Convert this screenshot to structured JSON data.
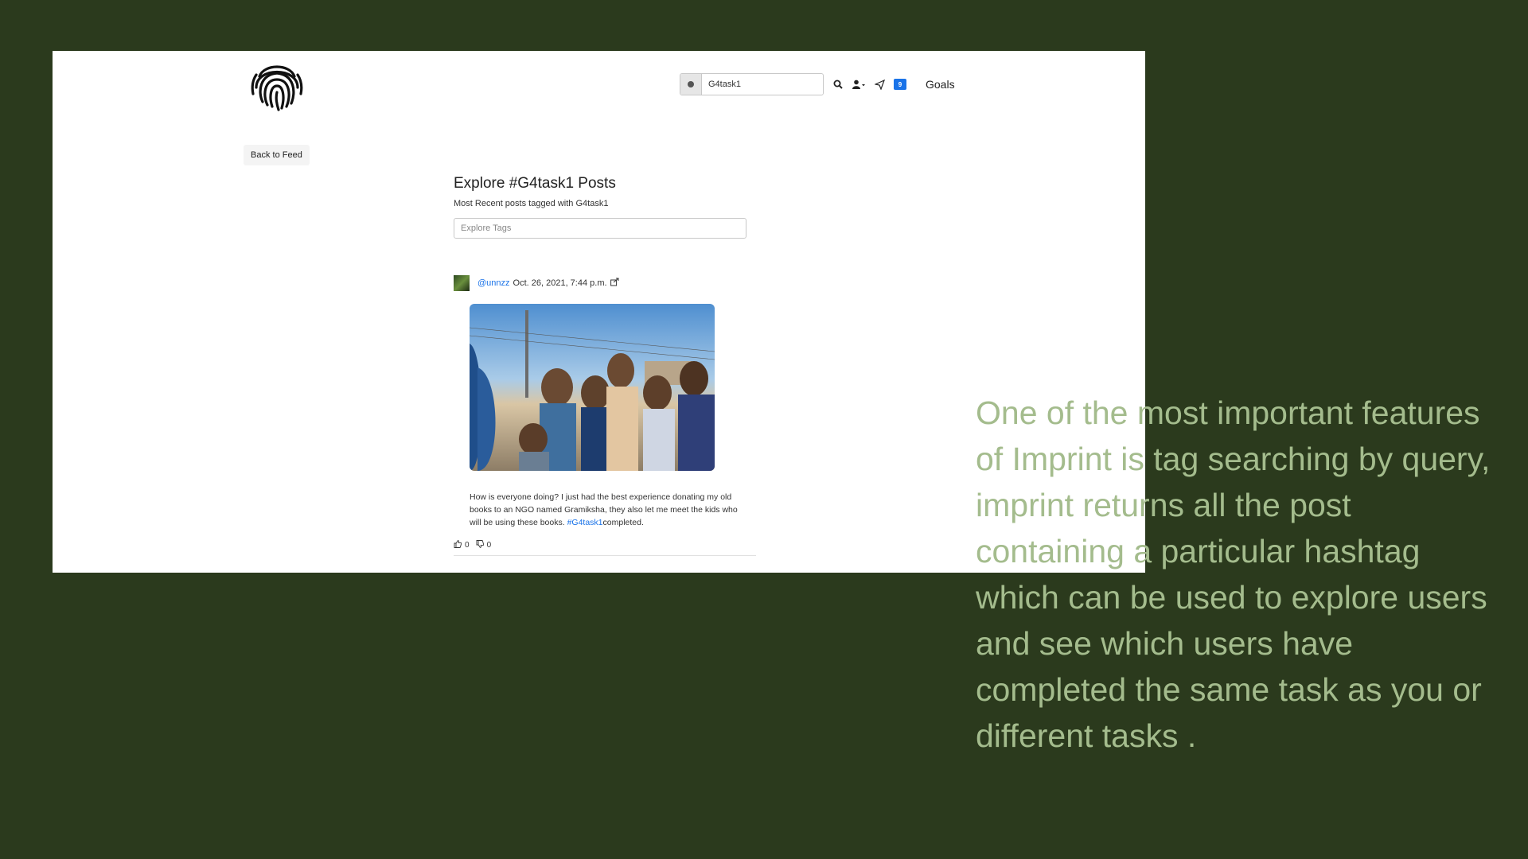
{
  "colors": {
    "background": "#2b3a1d",
    "caption": "#a4bc8d",
    "link": "#1a73e8"
  },
  "header": {
    "logo_icon": "fingerprint-icon",
    "search_value": "G4task1",
    "notification_count": "9",
    "goals_label": "Goals"
  },
  "back_button_label": "Back to Feed",
  "explore": {
    "title": "Explore #G4task1 Posts",
    "subtitle": "Most Recent posts tagged with G4task1",
    "tag_placeholder": "Explore Tags"
  },
  "post": {
    "username": "@unnzz",
    "timestamp": "Oct. 26, 2021, 7:44 p.m.",
    "text_before": "How is everyone doing? I just had the best experience donating my old books to an NGO named Gramiksha, they also let me meet the kids who will be using these books. ",
    "hashtag": "#G4task1",
    "text_after": "completed.",
    "likes": "0",
    "dislikes": "0"
  },
  "caption": "One of the most important features of Imprint is tag searching by query, imprint returns all the post containing a particular hashtag which can be used to explore users and see which users have completed the same task as you or different tasks ."
}
